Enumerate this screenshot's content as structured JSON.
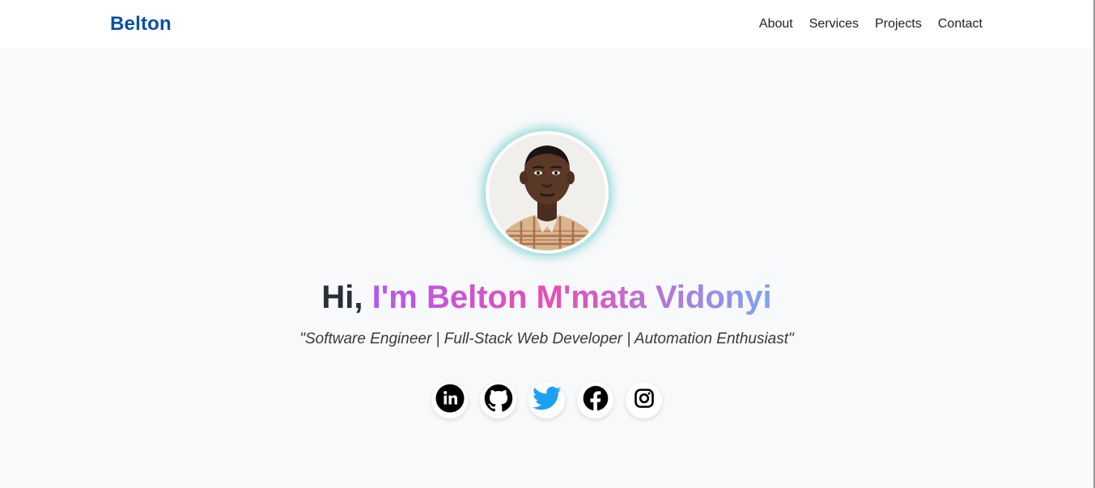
{
  "nav": {
    "brand": "Belton",
    "links": [
      {
        "label": "About"
      },
      {
        "label": "Services"
      },
      {
        "label": "Projects"
      },
      {
        "label": "Contact"
      }
    ]
  },
  "hero": {
    "greeting": "Hi,",
    "name": "I'm Belton M'mata Vidonyi",
    "tagline": "\"Software Engineer | Full-Stack Web Developer | Automation Enthusiast\""
  },
  "socials": [
    {
      "icon": "linkedin-icon"
    },
    {
      "icon": "github-icon"
    },
    {
      "icon": "twitter-icon",
      "color": "#1da1f2"
    },
    {
      "icon": "facebook-icon"
    },
    {
      "icon": "instagram-icon"
    }
  ],
  "colors": {
    "brand": "#0a4fa6",
    "avatar_glow": "#38beba",
    "name_gradient": [
      "#b25af0",
      "#e64fb0",
      "#7aa6f2"
    ]
  }
}
